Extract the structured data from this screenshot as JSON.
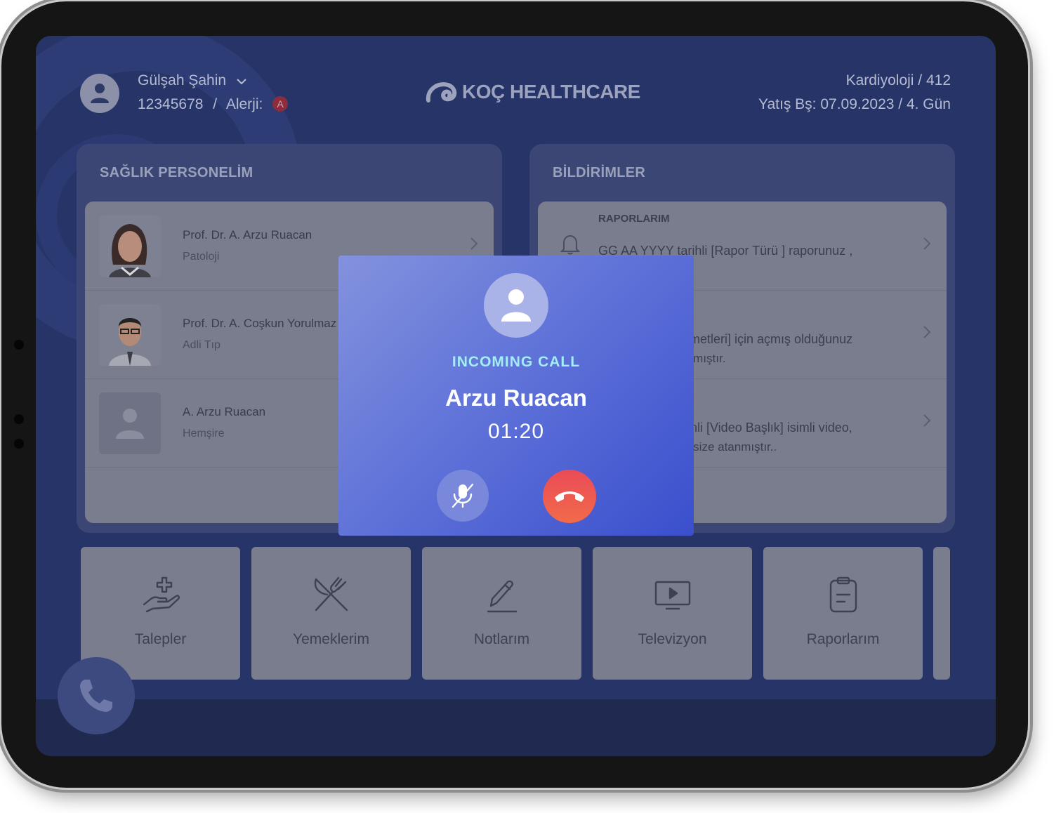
{
  "patient": {
    "name": "Gülşah Şahin",
    "id": "12345678",
    "separator": "/",
    "allergy_label": "Alerji:",
    "allergy_badge": "A"
  },
  "brand": {
    "name": "KOÇ HEALTHCARE"
  },
  "stay": {
    "department": "Kardiyoloji / 412",
    "admission": "Yatış Bş: 07.09.2023 / 4. Gün"
  },
  "staff_panel": {
    "title": "SAĞLIK PERSONELİM",
    "items": [
      {
        "name": "Prof. Dr. A. Arzu Ruacan",
        "dept": "Patoloji"
      },
      {
        "name": "Prof. Dr. A. Coşkun Yorulmaz",
        "dept": "Adli Tıp"
      },
      {
        "name": "A. Arzu Ruacan",
        "dept": "Hemşire"
      }
    ]
  },
  "notifications_panel": {
    "title": "BİLDİRİMLER",
    "items": [
      {
        "title": "RAPORLARIM",
        "line1": "GG AA YYYY tarihli [Rapor Türü ] raporunuz ,",
        "line2": ""
      },
      {
        "title": "",
        "line1": "zmetleri] için açmış olduğunuz",
        "line2": "ınmıştır."
      },
      {
        "title": "",
        "line1": "rihli [Video Başlık] isimli video,",
        "line2": "e size atanmıştır.."
      }
    ]
  },
  "tiles": [
    {
      "label": "Talepler",
      "icon": "hand-plus-icon"
    },
    {
      "label": "Yemeklerim",
      "icon": "fork-knife-icon"
    },
    {
      "label": "Notlarım",
      "icon": "pencil-icon"
    },
    {
      "label": "Televizyon",
      "icon": "tv-icon"
    },
    {
      "label": "Raporlarım",
      "icon": "clipboard-icon"
    }
  ],
  "call": {
    "status": "INCOMING CALL",
    "caller": "Arzu Ruacan",
    "timer": "01:20"
  },
  "colors": {
    "screen_bg": "#263468",
    "call_gradient_start": "#8392dd",
    "call_gradient_end": "#3a4fcd",
    "end_call": "#ea4b57",
    "call_label": "#a2eef5"
  }
}
